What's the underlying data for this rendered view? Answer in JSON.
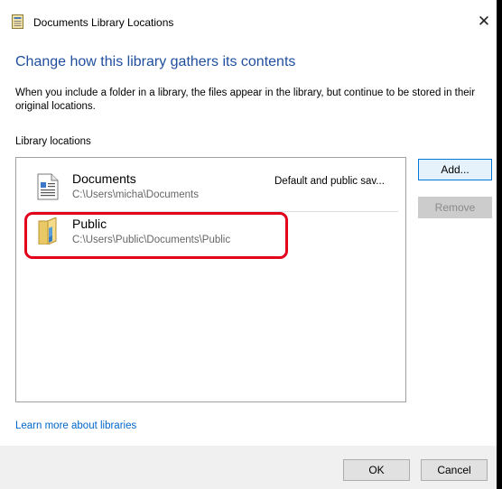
{
  "window": {
    "title": "Documents Library Locations",
    "close_glyph": "✕"
  },
  "content": {
    "heading": "Change how this library gathers its contents",
    "description": "When you include a folder in a library, the files appear in the library, but continue to be stored in their original locations.",
    "locations_label": "Library locations"
  },
  "locations": [
    {
      "name": "Documents",
      "path": "C:\\Users\\micha\\Documents",
      "note": "Default and public sav...",
      "icon": "documents-folder-icon"
    },
    {
      "name": "Public",
      "path": "C:\\Users\\Public\\Documents\\Public",
      "note": "",
      "icon": "public-folder-icon"
    }
  ],
  "buttons": {
    "add": "Add...",
    "remove": "Remove",
    "ok": "OK",
    "cancel": "Cancel"
  },
  "links": {
    "learn_more": "Learn more about libraries"
  },
  "colors": {
    "heading": "#1f4e9e",
    "link": "#0066cc",
    "highlight": "#e2001a",
    "add_border": "#0078d7"
  }
}
